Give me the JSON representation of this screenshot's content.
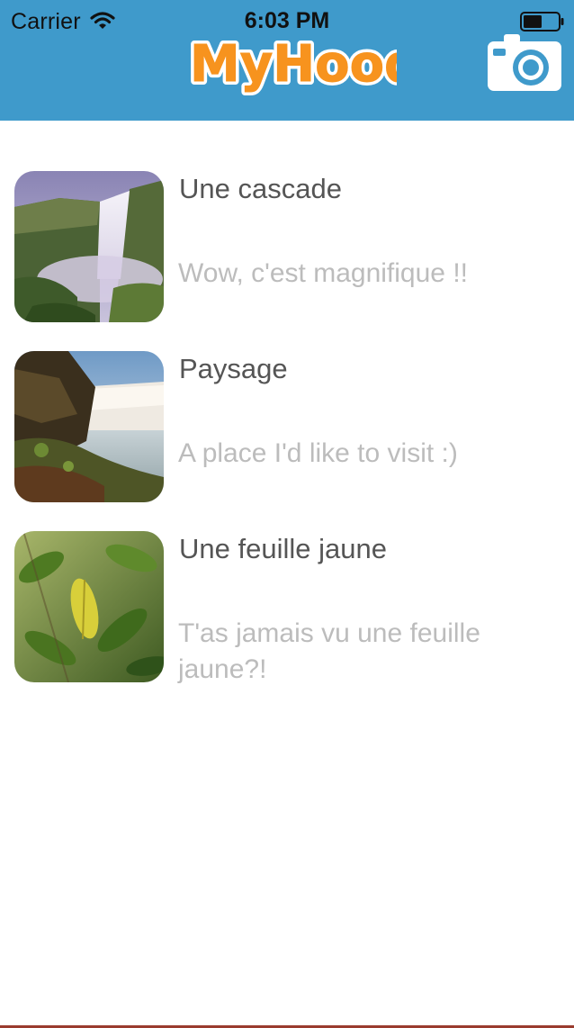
{
  "status_bar": {
    "carrier": "Carrier",
    "time": "6:03 PM",
    "wifi_icon": "wifi-icon",
    "battery_icon": "battery-icon"
  },
  "header": {
    "logo_text": "MyHood",
    "background_color": "#3f9acb",
    "logo_color": "#f7931e",
    "camera_icon": "camera-icon"
  },
  "feed": {
    "items": [
      {
        "title": "Une cascade",
        "description": "Wow, c'est magnifique !!",
        "image": "waterfall-photo"
      },
      {
        "title": "Paysage",
        "description": "A place I'd like to visit :)",
        "image": "landscape-photo"
      },
      {
        "title": "Une feuille jaune",
        "description": "T'as jamais vu une feuille jaune?!",
        "image": "yellow-leaf-photo"
      }
    ],
    "title_color": "#555555",
    "description_color": "#bcbcbc"
  }
}
